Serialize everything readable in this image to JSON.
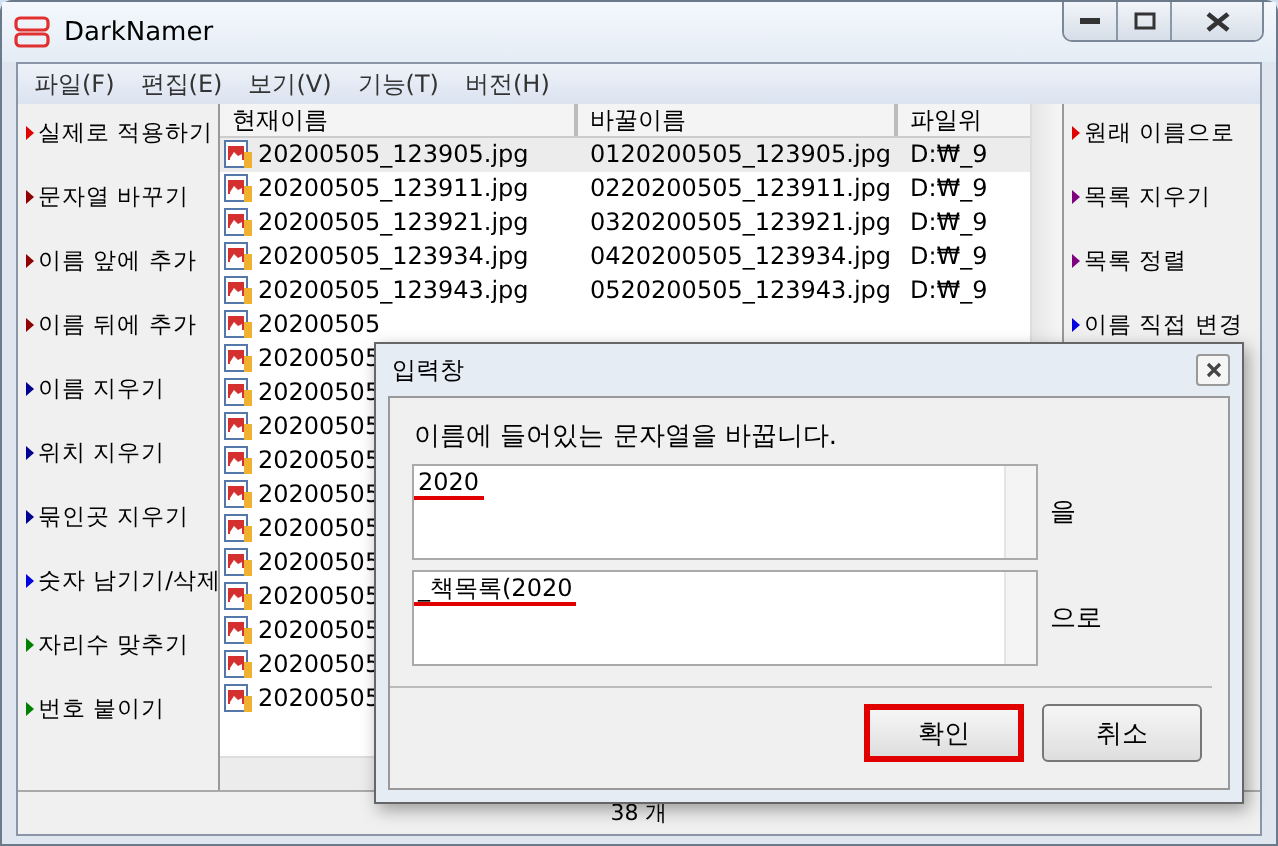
{
  "window": {
    "title": "DarkNamer"
  },
  "menu": [
    "파일(F)",
    "편집(E)",
    "보기(V)",
    "기능(T)",
    "버전(H)"
  ],
  "left_actions": [
    {
      "label": "실제로 적용하기",
      "color": "#e00000"
    },
    {
      "label": "문자열 바꾸기",
      "color": "#900000"
    },
    {
      "label": "이름 앞에 추가",
      "color": "#900000"
    },
    {
      "label": "이름 뒤에 추가",
      "color": "#900000"
    },
    {
      "label": "이름 지우기",
      "color": "#000090"
    },
    {
      "label": "위치 지우기",
      "color": "#000090"
    },
    {
      "label": "묶인곳 지우기",
      "color": "#000090"
    },
    {
      "label": "숫자 남기기/삭제",
      "color": "#0000e0"
    },
    {
      "label": "자리수 맞추기",
      "color": "#008000"
    },
    {
      "label": "번호 붙이기",
      "color": "#008000"
    }
  ],
  "table": {
    "columns": [
      "현재이름",
      "바꿀이름",
      "파일위"
    ],
    "rows": [
      {
        "cells": [
          "20200505_123905.jpg",
          "0120200505_123905.jpg",
          "D:₩_9"
        ],
        "selected": true
      },
      {
        "cells": [
          "20200505_123911.jpg",
          "0220200505_123911.jpg",
          "D:₩_9"
        ],
        "selected": false
      },
      {
        "cells": [
          "20200505_123921.jpg",
          "0320200505_123921.jpg",
          "D:₩_9"
        ],
        "selected": false
      },
      {
        "cells": [
          "20200505_123934.jpg",
          "0420200505_123934.jpg",
          "D:₩_9"
        ],
        "selected": false
      },
      {
        "cells": [
          "20200505_123943.jpg",
          "0520200505_123943.jpg",
          "D:₩_9"
        ],
        "selected": false
      },
      {
        "cells": [
          "20200505"
        ],
        "selected": false
      },
      {
        "cells": [
          "20200505"
        ],
        "selected": false
      },
      {
        "cells": [
          "20200505"
        ],
        "selected": false
      },
      {
        "cells": [
          "20200505"
        ],
        "selected": false
      },
      {
        "cells": [
          "20200505"
        ],
        "selected": false
      },
      {
        "cells": [
          "20200505"
        ],
        "selected": false
      },
      {
        "cells": [
          "20200505"
        ],
        "selected": false
      },
      {
        "cells": [
          "20200505"
        ],
        "selected": false
      },
      {
        "cells": [
          "20200505"
        ],
        "selected": false
      },
      {
        "cells": [
          "20200505"
        ],
        "selected": false
      },
      {
        "cells": [
          "20200505"
        ],
        "selected": false
      },
      {
        "cells": [
          "20200505"
        ],
        "selected": false
      }
    ]
  },
  "right_actions": [
    {
      "label": "원래 이름으로",
      "color": "#e00000"
    },
    {
      "label": "목록 지우기",
      "color": "#800080"
    },
    {
      "label": "목록 정렬",
      "color": "#800080"
    },
    {
      "label": "이름 직접 변경",
      "color": "#0000e0"
    }
  ],
  "status_bar": "38 개",
  "dialog": {
    "title": "입력창",
    "message": "이름에 들어있는 문자열을 바꿉니다.",
    "fields": [
      {
        "value": "2020",
        "suffix": "을",
        "underlined": true
      },
      {
        "value": "_책목록(2020",
        "suffix": "으로",
        "underlined": true
      }
    ],
    "buttons": [
      {
        "label": "확인",
        "highlighted": true
      },
      {
        "label": "취소",
        "highlighted": false
      }
    ]
  }
}
